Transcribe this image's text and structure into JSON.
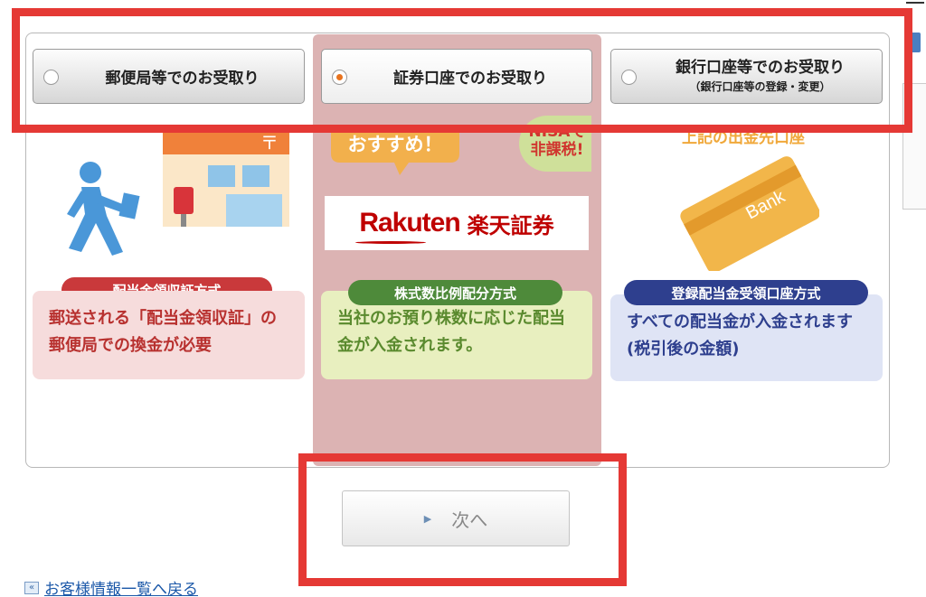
{
  "options": [
    {
      "label": "郵便局等でのお受取り",
      "sub": "",
      "selected": false
    },
    {
      "label": "証券口座でのお受取り",
      "sub": "",
      "selected": true
    },
    {
      "label": "銀行口座等でのお受取り",
      "sub": "（銀行口座等の登録・変更）",
      "selected": false
    }
  ],
  "left": {
    "badge": "配当金領収証方式",
    "desc": "郵送される「配当金領収証」の郵便局での換金が必要"
  },
  "middle": {
    "bubble": "おすすめ！",
    "nisa_line1": "NISAで",
    "nisa_line2": "非課税!",
    "logo_en": "Rakuten",
    "logo_jp": "楽天証券",
    "badge": "株式数比例配分方式",
    "desc": "当社のお預り株数に応じた配当金が入金されます。"
  },
  "right": {
    "top_text": "上記の出金先口座",
    "card_text": "Bank",
    "badge": "登録配当金受領口座方式",
    "desc": "すべての配当金が入金されます(税引後の金額)"
  },
  "next_button": "次へ",
  "back_link": "お客様情報一覧へ戻る",
  "back_icon": "«",
  "colors": {
    "highlight": "#dcb3b3",
    "annotation_red": "#e53935",
    "radio_selected": "#e8731e",
    "left_badge": "#c9393b",
    "mid_badge": "#4e8a3a",
    "right_badge": "#2e3f8e",
    "rakuten_red": "#bf0000"
  }
}
